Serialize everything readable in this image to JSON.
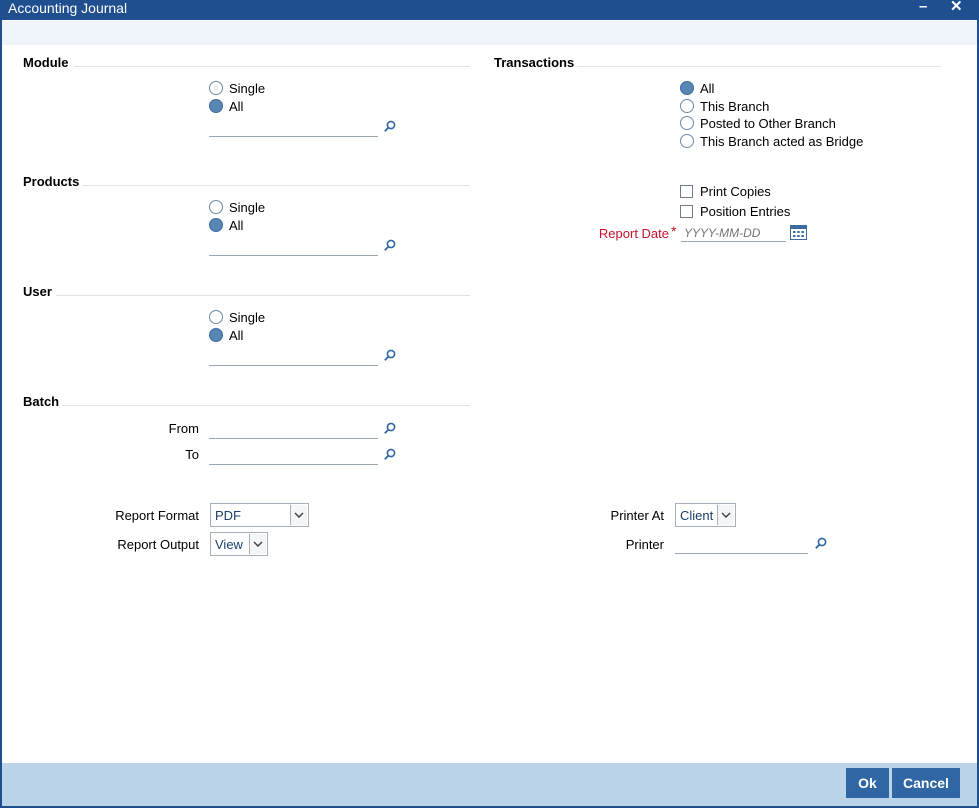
{
  "window": {
    "title": "Accounting Journal"
  },
  "sections": {
    "module": {
      "title": "Module",
      "options": [
        {
          "label": "Single",
          "checked": false
        },
        {
          "label": "All",
          "checked": true
        }
      ],
      "input_value": ""
    },
    "products": {
      "title": "Products",
      "options": [
        {
          "label": "Single",
          "checked": false
        },
        {
          "label": "All",
          "checked": true
        }
      ],
      "input_value": ""
    },
    "user": {
      "title": "User",
      "options": [
        {
          "label": "Single",
          "checked": false
        },
        {
          "label": "All",
          "checked": true
        }
      ],
      "input_value": ""
    },
    "batch": {
      "title": "Batch",
      "from_label": "From",
      "to_label": "To",
      "from_value": "",
      "to_value": ""
    },
    "transactions": {
      "title": "Transactions",
      "options": [
        {
          "label": "All",
          "checked": true
        },
        {
          "label": "This Branch",
          "checked": false
        },
        {
          "label": "Posted to Other Branch",
          "checked": false
        },
        {
          "label": "This Branch acted as Bridge",
          "checked": false
        }
      ]
    }
  },
  "checkboxes": [
    {
      "label": "Print Copies",
      "checked": false
    },
    {
      "label": "Position Entries",
      "checked": false
    }
  ],
  "report_date": {
    "label": "Report Date",
    "required_mark": "*",
    "placeholder": "YYYY-MM-DD",
    "value": ""
  },
  "report_format": {
    "label": "Report Format",
    "value": "PDF"
  },
  "report_output": {
    "label": "Report Output",
    "value": "View"
  },
  "printer_at": {
    "label": "Printer At",
    "value": "Client"
  },
  "printer": {
    "label": "Printer",
    "value": ""
  },
  "buttons": {
    "ok": "Ok",
    "cancel": "Cancel"
  },
  "colors": {
    "titlebar": "#1f4f8f",
    "footer": "#bcd4ea",
    "button": "#2f66a3",
    "required": "#c8102e"
  },
  "icons": {
    "minimize": "minimize-icon",
    "close": "close-icon",
    "lookup": "search-icon",
    "calendar": "calendar-icon",
    "dropdown": "chevron-down-icon"
  }
}
